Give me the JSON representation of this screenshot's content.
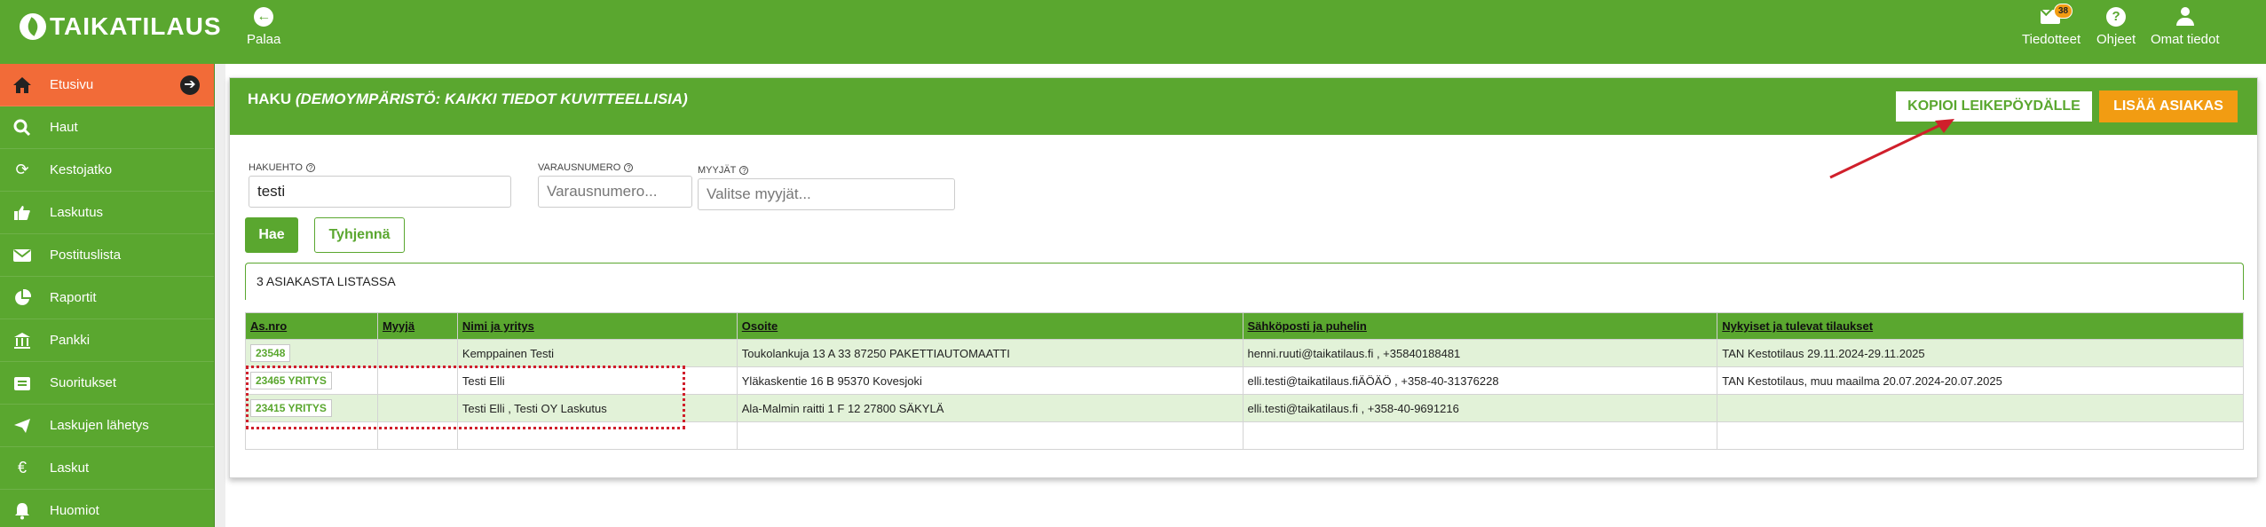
{
  "brand": {
    "name": "TAIKATILAUS"
  },
  "topbar": {
    "back_label": "Palaa",
    "news_label": "Tiedotteet",
    "news_badge": "38",
    "help_label": "Ohjeet",
    "profile_label": "Omat tiedot"
  },
  "sidebar": {
    "items": [
      {
        "label": "Etusivu",
        "icon": "home-icon"
      },
      {
        "label": "Haut",
        "icon": "search-icon"
      },
      {
        "label": "Kestojatko",
        "icon": "refresh-icon"
      },
      {
        "label": "Laskutus",
        "icon": "thumbs-up-icon"
      },
      {
        "label": "Postituslista",
        "icon": "envelope-icon"
      },
      {
        "label": "Raportit",
        "icon": "pie-chart-icon"
      },
      {
        "label": "Pankki",
        "icon": "bank-icon"
      },
      {
        "label": "Suoritukset",
        "icon": "wallet-icon"
      },
      {
        "label": "Laskujen lähetys",
        "icon": "paper-plane-icon"
      },
      {
        "label": "Laskut",
        "icon": "euro-icon"
      },
      {
        "label": "Huomiot",
        "icon": "bell-icon"
      }
    ]
  },
  "panel": {
    "title_main": "HAKU ",
    "title_note": "(DEMOYMPÄRISTÖ: KAIKKI TIEDOT KUVITTEELLISIA)",
    "copy_button": "KOPIOI LEIKEPÖYDÄLLE",
    "add_button": "LISÄÄ ASIAKAS"
  },
  "search": {
    "hakuehto_label": "HAKUEHTO",
    "hakuehto_value": "testi",
    "varausnumero_label": "VARAUSNUMERO",
    "varausnumero_placeholder": "Varausnumero...",
    "myyjat_label": "MYYJÄT",
    "myyjat_placeholder": "Valitse myyjät...",
    "search_button": "Hae",
    "clear_button": "Tyhjennä"
  },
  "results": {
    "count_text": "3 ASIAKASTA LISTASSA",
    "columns": [
      "As.nro",
      "Myyjä",
      "Nimi ja yritys",
      "Osoite",
      "Sähköposti ja puhelin",
      "Nykyiset ja tulevat tilaukset"
    ],
    "rows": [
      {
        "id": "23548",
        "seller": "",
        "name": "Kemppainen Testi",
        "address": "Toukolankuja 13 A 33 87250 PAKETTIAUTOMAATTI",
        "contact": "henni.ruuti@taikatilaus.fi , +35840188481",
        "orders": "TAN Kestotilaus 29.11.2024-29.11.2025"
      },
      {
        "id": "23465 YRITYS",
        "seller": "",
        "name": "Testi Elli",
        "address": "Yläkaskentie 16 B 95370 Kovesjoki",
        "contact": "elli.testi@taikatilaus.fiÄÖÄÖ , +358-40-31376228",
        "orders": "TAN Kestotilaus, muu maailma 20.07.2024-20.07.2025"
      },
      {
        "id": "23415 YRITYS",
        "seller": "",
        "name": "Testi Elli , Testi OY Laskutus",
        "address": "Ala-Malmin raitti 1 F 12 27800 SÄKYLÄ",
        "contact": "elli.testi@taikatilaus.fi , +358-40-9691216",
        "orders": ""
      }
    ]
  },
  "colors": {
    "brand_green": "#5aa72f",
    "active_orange": "#f26b38",
    "accent_orange": "#f29c12",
    "annotation_red": "#d01f2b"
  }
}
